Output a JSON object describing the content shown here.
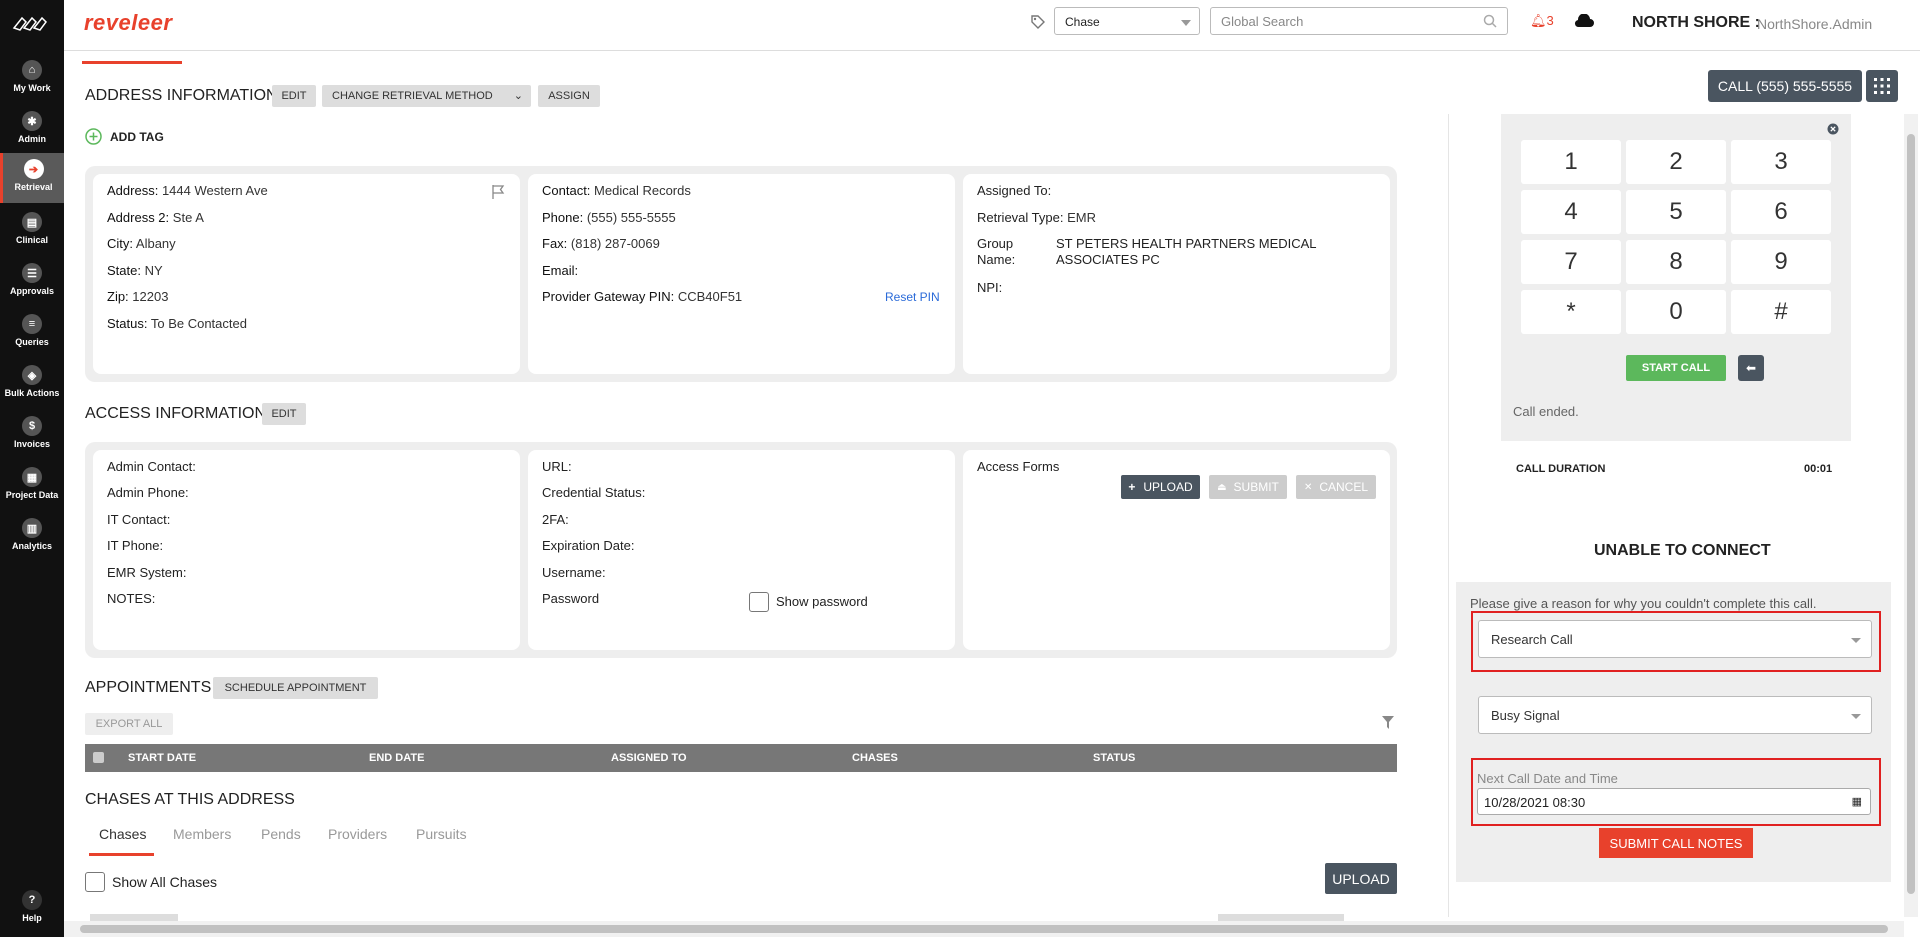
{
  "brand": "reveleer",
  "sidebar": {
    "items": [
      {
        "label": "My Work",
        "icon": "home-icon"
      },
      {
        "label": "Admin",
        "icon": "gear-icon"
      },
      {
        "label": "Retrieval",
        "icon": "retrieval-arrow-icon"
      },
      {
        "label": "Clinical",
        "icon": "clinical-icon"
      },
      {
        "label": "Approvals",
        "icon": "list-icon"
      },
      {
        "label": "Queries",
        "icon": "queries-icon"
      },
      {
        "label": "Bulk Actions",
        "icon": "layers-icon"
      },
      {
        "label": "Invoices",
        "icon": "dollar-icon"
      },
      {
        "label": "Project Data",
        "icon": "project-data-icon"
      },
      {
        "label": "Analytics",
        "icon": "chart-icon"
      }
    ],
    "help_label": "Help"
  },
  "header": {
    "chase_select_value": "Chase",
    "search_placeholder": "Global Search",
    "notification_count": "3",
    "org_name": "NORTH SHORE :",
    "user_name": "NorthShore.Admin"
  },
  "call_button_label": "CALL (555) 555-5555",
  "address_info": {
    "title": "ADDRESS INFORMATION",
    "edit_label": "EDIT",
    "change_method_label": "CHANGE RETRIEVAL METHOD",
    "assign_label": "ASSIGN",
    "add_tag_label": "ADD TAG",
    "col1": [
      {
        "label": "Address:",
        "value": "1444 Western Ave"
      },
      {
        "label": "Address 2:",
        "value": "Ste A"
      },
      {
        "label": "City:",
        "value": "Albany"
      },
      {
        "label": "State:",
        "value": "NY"
      },
      {
        "label": "Zip:",
        "value": "12203"
      },
      {
        "label": "Status:",
        "value": "To Be Contacted"
      }
    ],
    "col2": [
      {
        "label": "Contact:",
        "value": "Medical Records"
      },
      {
        "label": "Phone:",
        "value": "(555) 555-5555"
      },
      {
        "label": "Fax:",
        "value": "(818) 287-0069"
      },
      {
        "label": "Email:",
        "value": ""
      },
      {
        "label": "Provider Gateway PIN:",
        "value": "CCB40F51"
      }
    ],
    "reset_pin_label": "Reset PIN",
    "col3": {
      "assigned_to_label": "Assigned To:",
      "retrieval_type_label": "Retrieval Type:",
      "retrieval_type_value": "EMR",
      "group_name_label_1": "Group",
      "group_name_label_2": "Name:",
      "group_name_value_1": "ST PETERS HEALTH PARTNERS MEDICAL",
      "group_name_value_2": "ASSOCIATES PC",
      "npi_label": "NPI:"
    }
  },
  "access_info": {
    "title": "ACCESS INFORMATION",
    "edit_label": "EDIT",
    "col1": [
      "Admin Contact:",
      "Admin Phone:",
      "IT Contact:",
      "IT Phone:",
      "EMR System:",
      "NOTES:"
    ],
    "col2": [
      "URL:",
      "Credential Status:",
      "2FA:",
      "Expiration Date:",
      "Username:",
      "Password"
    ],
    "show_password_label": "Show password",
    "access_forms_label": "Access Forms",
    "upload_label": "UPLOAD",
    "submit_label": "SUBMIT",
    "cancel_label": "CANCEL"
  },
  "appointments": {
    "title": "APPOINTMENTS",
    "schedule_label": "SCHEDULE APPOINTMENT",
    "export_label": "EXPORT ALL",
    "columns": [
      "START DATE",
      "END DATE",
      "ASSIGNED TO",
      "CHASES",
      "STATUS"
    ]
  },
  "chases": {
    "title": "CHASES AT THIS ADDRESS",
    "tabs": [
      "Chases",
      "Members",
      "Pends",
      "Providers",
      "Pursuits"
    ],
    "show_all_label": "Show All Chases",
    "upload_label": "UPLOAD"
  },
  "dialer": {
    "keys": [
      "1",
      "2",
      "3",
      "4",
      "5",
      "6",
      "7",
      "8",
      "9",
      "*",
      "0",
      "#"
    ],
    "start_call_label": "START CALL",
    "status_text": "Call ended.",
    "duration_label": "CALL DURATION",
    "duration_value": "00:01"
  },
  "unable": {
    "title": "UNABLE TO CONNECT",
    "prompt": "Please give a reason for why you couldn't complete this call.",
    "reason_value": "Research Call",
    "sub_reason_value": "Busy Signal",
    "next_call_label": "Next Call Date and Time",
    "next_call_value": "10/28/2021 08:30",
    "submit_label": "SUBMIT CALL NOTES"
  },
  "colors": {
    "brand": "#e8412c",
    "dark_button": "#4a5560",
    "green": "#5cb85c"
  }
}
